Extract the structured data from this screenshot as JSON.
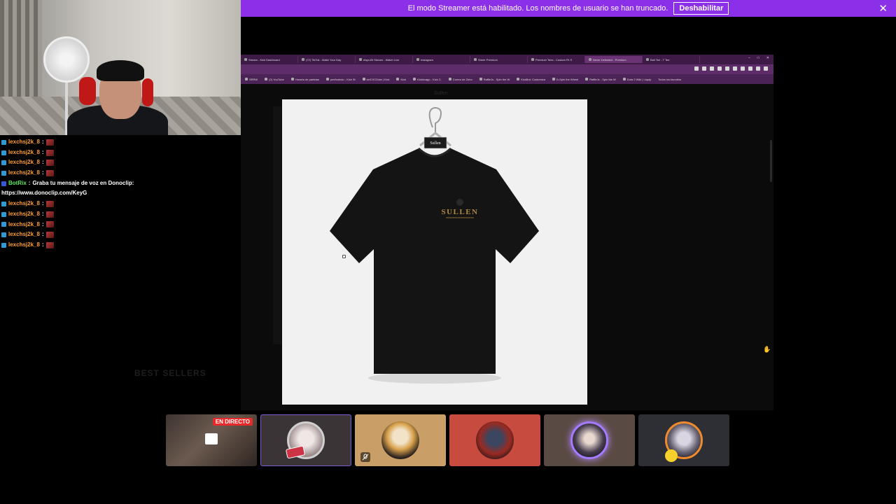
{
  "banner": {
    "text": "El modo Streamer está habilitado. Los nombres de usuario se han truncado.",
    "button_label": "Deshabilitar",
    "close_icon": "close-icon",
    "color": "#8c2fe8"
  },
  "chat": {
    "messages": [
      {
        "user": "lexchsj2k_8",
        "sep": ":",
        "type": "emote"
      },
      {
        "user": "lexchsj2k_8",
        "sep": ":",
        "type": "emote"
      },
      {
        "user": "lexchsj2k_8",
        "sep": ":",
        "type": "emote"
      },
      {
        "user": "lexchsj2k_8",
        "sep": ":",
        "type": "emote"
      },
      {
        "user": "BotRix",
        "sep": ":",
        "text": "Graba tu mensaje de voz en Donoclip:",
        "text2": "https://www.donoclip.com/KeyG"
      },
      {
        "user": "lexchsj2k_8",
        "sep": ":",
        "type": "emote"
      },
      {
        "user": "lexchsj2k_8",
        "sep": ":",
        "type": "emote"
      },
      {
        "user": "lexchsj2k_8",
        "sep": ":",
        "type": "emote"
      },
      {
        "user": "lexchsj2k_8",
        "sep": ":",
        "type": "emote"
      },
      {
        "user": "lexchsj2k_8",
        "sep": ":",
        "type": "emote"
      }
    ]
  },
  "browser": {
    "tabs": [
      {
        "label": "Stream - Kick Dashboard",
        "active": false
      },
      {
        "label": "(72) TikTok - Make Your Day",
        "active": false
      },
      {
        "label": "elspu26 Stream - Watch Live",
        "active": false
      },
      {
        "label": "Instagram",
        "active": false
      },
      {
        "label": "Sheer Premium",
        "active": false
      },
      {
        "label": "Premium Tees - Custom Fit S",
        "active": false
      },
      {
        "label": "Never Defeated - Premium",
        "active": true
      },
      {
        "label": "Ball Tee - T Tee",
        "active": false
      }
    ],
    "bookmarks": [
      "SRRW",
      "(2) YouTube",
      "Horario de partidas",
      "pm/foobolo - Kick St",
      "keiCXCDota | Kick",
      "Kick",
      "Kickbcapp - Kick C.",
      "Correo de Zoho",
      "RaffleJs - Spin the W",
      "KickBot: Customiza",
      "D-Spin the Wheel",
      "RaffleJs - Spin the W",
      "Dota 2 Wiki | Liquip",
      "Todos los favoritos"
    ],
    "page_ghost_title": "Sullen",
    "bestseller_label": "BEST SELLERS"
  },
  "product": {
    "tag_text": "Sullen",
    "logo_text": "SULLEN",
    "shirt_color": "#141414",
    "background": "#f1f1f1"
  },
  "streamers": {
    "live_badge": "EN DIRECTO",
    "cards": [
      {
        "name": "live-preview",
        "style": "live"
      },
      {
        "name": "channel-1",
        "style": "selected"
      },
      {
        "name": "channel-2",
        "style": "gold"
      },
      {
        "name": "channel-3",
        "style": "red"
      },
      {
        "name": "channel-4",
        "style": "taupe"
      },
      {
        "name": "channel-5",
        "style": "slate"
      }
    ]
  }
}
